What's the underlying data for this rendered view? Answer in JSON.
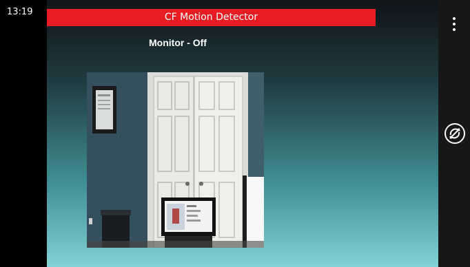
{
  "status_bar": {
    "time": "13:19"
  },
  "app": {
    "title": "CF Motion Detector",
    "monitor_status": "Monitor - Off"
  },
  "preview": {
    "description_icon": "camera-preview"
  },
  "app_bar": {
    "more_icon": "ellipsis-vertical-icon",
    "sync_icon": "sync-disabled-icon"
  },
  "colors": {
    "title_bar": "#e81d23",
    "background_top": "#101418",
    "background_bottom": "#82d3d5",
    "app_bar": "#171717"
  }
}
